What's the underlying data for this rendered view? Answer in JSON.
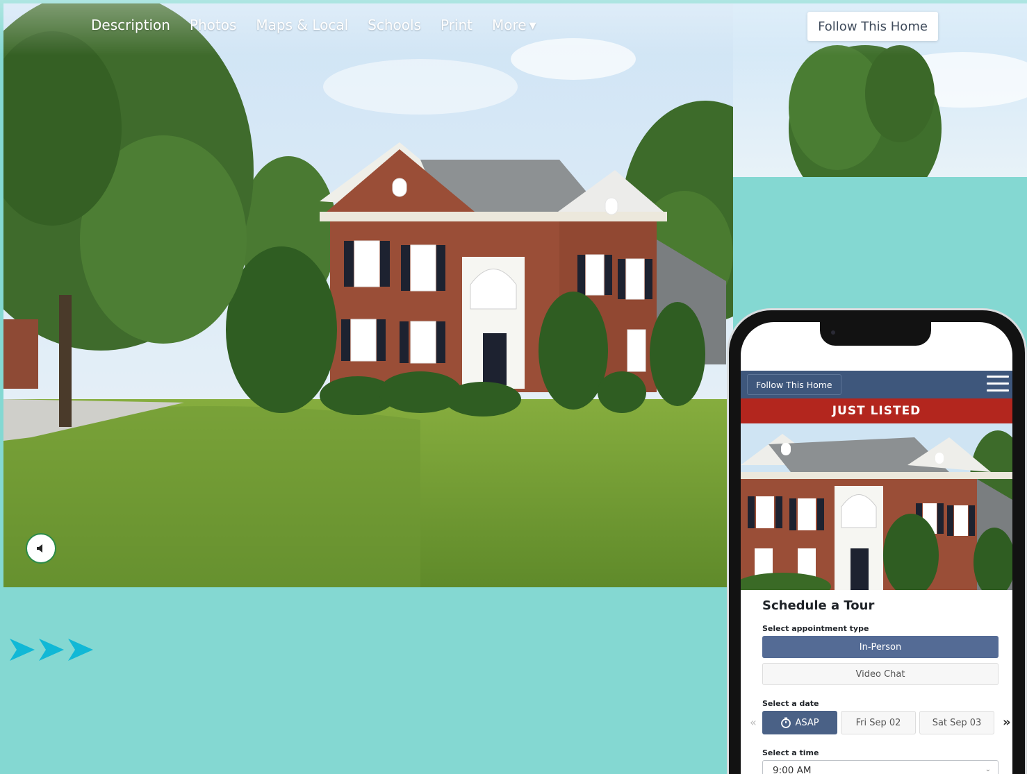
{
  "nav": {
    "items": [
      {
        "label": "Description"
      },
      {
        "label": "Photos"
      },
      {
        "label": "Maps & Local"
      },
      {
        "label": "Schools"
      },
      {
        "label": "Print"
      },
      {
        "label": "More"
      }
    ],
    "follow_label": "Follow This Home"
  },
  "hero": {
    "mute_icon": "speaker-muted-icon"
  },
  "decor": {
    "arrow_color": "#11b8d6",
    "background_color": "#84d8d2"
  },
  "phone": {
    "header": {
      "follow_label": "Follow This Home",
      "menu_icon": "hamburger-menu-icon",
      "color": "#3e577c"
    },
    "banner": {
      "text": "JUST LISTED",
      "color": "#b3261e"
    },
    "schedule": {
      "title": "Schedule a Tour",
      "appointment_label": "Select appointment type",
      "appointment_options": [
        {
          "label": "In-Person",
          "selected": true
        },
        {
          "label": "Video Chat",
          "selected": false
        }
      ],
      "date_label": "Select a date",
      "dates": [
        {
          "label": "ASAP",
          "icon": "stopwatch-icon",
          "selected": true
        },
        {
          "label": "Fri Sep 02",
          "selected": false
        },
        {
          "label": "Sat Sep 03",
          "selected": false
        }
      ],
      "time_label": "Select a time",
      "time_value": "9:00 AM"
    }
  }
}
